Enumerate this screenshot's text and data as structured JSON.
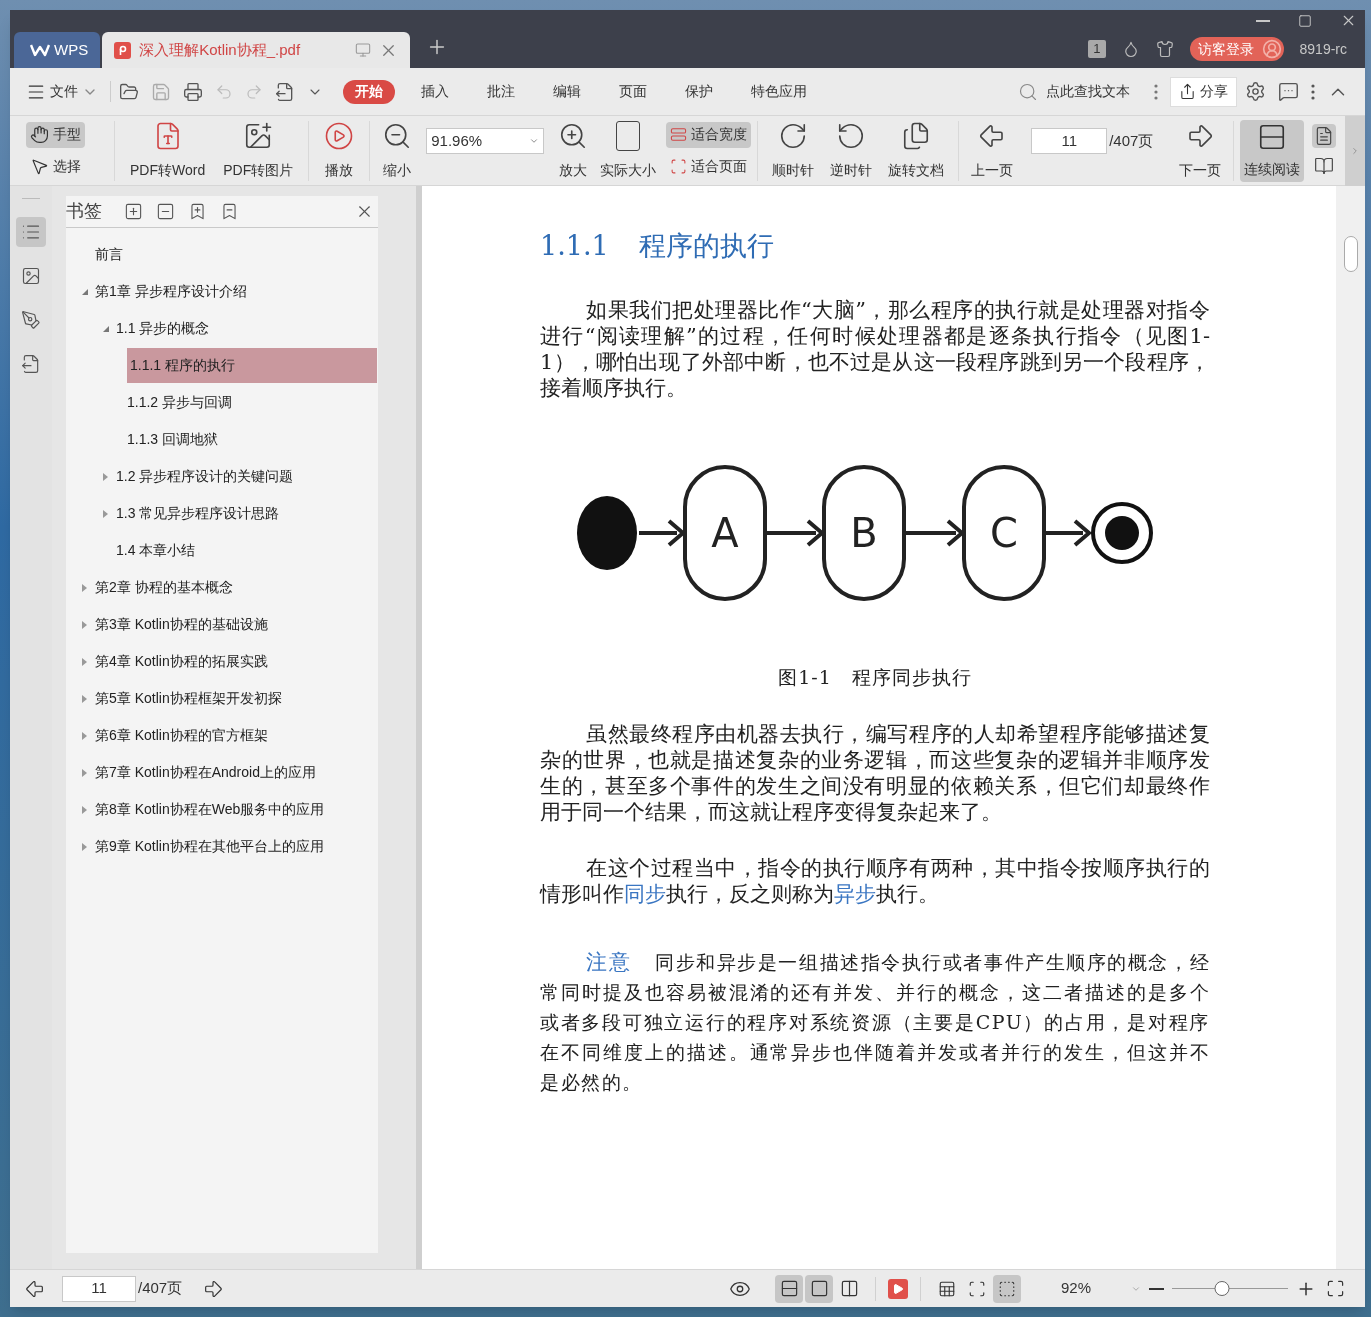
{
  "tabs": [
    {
      "kind": "home",
      "label": "WPS",
      "selected": false
    },
    {
      "kind": "document",
      "label": "深入理解Kotlin协程_.pdf",
      "selected": true
    }
  ],
  "title_bar": {
    "badge": "1",
    "login": "访客登录",
    "account": "8919-rc"
  },
  "menu_bar": {
    "file": "文件",
    "tabs": [
      {
        "label": "开始",
        "selected": true
      },
      {
        "label": "插入",
        "selected": false
      },
      {
        "label": "批注",
        "selected": false
      },
      {
        "label": "编辑",
        "selected": false
      },
      {
        "label": "页面",
        "selected": false
      },
      {
        "label": "保护",
        "selected": false
      },
      {
        "label": "特色应用",
        "selected": false
      }
    ],
    "search": {
      "placeholder": "点此查找文本"
    },
    "share": "分享"
  },
  "toolbar": {
    "modes": [
      {
        "kind": "hand",
        "label": "手型",
        "selected": true
      },
      {
        "kind": "select",
        "label": "选择",
        "selected": false
      }
    ],
    "convert_tools": [
      {
        "kind": "pdf-to-word",
        "label": "PDF转Word"
      },
      {
        "kind": "pdf-to-image",
        "label": "PDF转图片"
      },
      {
        "kind": "play",
        "label": "播放"
      }
    ],
    "zoom_out": "缩小",
    "zoom": "91.96%",
    "zoom_in": "放大",
    "actual_size": "实际大小",
    "fits": [
      {
        "kind": "fit-width",
        "label": "适合宽度",
        "selected": true
      },
      {
        "kind": "fit-page",
        "label": "适合页面",
        "selected": false
      }
    ],
    "rotate_tools": [
      {
        "kind": "clockwise",
        "label": "顺时针"
      },
      {
        "kind": "counterclockwise",
        "label": "逆时针"
      },
      {
        "kind": "rotate-document",
        "label": "旋转文档"
      }
    ],
    "prev": "上一页",
    "page": "11",
    "total": "/407页",
    "next": "下一页",
    "continuous": {
      "label": "连续阅读",
      "selected": true
    }
  },
  "rail": [
    {
      "kind": "bookmarks",
      "selected": true
    },
    {
      "kind": "thumbnails",
      "selected": false
    },
    {
      "kind": "annotations",
      "selected": false
    },
    {
      "kind": "convert",
      "selected": false
    }
  ],
  "bookmarks": {
    "title": "书签",
    "items": [
      {
        "label": "前言",
        "selected": false
      },
      {
        "label": "第1章 异步程序设计介绍",
        "selected": false,
        "expanded": true,
        "children": [
          {
            "label": "1.1 异步的概念",
            "selected": false,
            "expanded": true,
            "children": [
              {
                "label": "1.1.1 程序的执行",
                "selected": true
              },
              {
                "label": "1.1.2 异步与回调",
                "selected": false
              },
              {
                "label": "1.1.3 回调地狱",
                "selected": false
              }
            ]
          },
          {
            "label": "1.2 异步程序设计的关键问题",
            "selected": false,
            "expanded": false
          },
          {
            "label": "1.3 常见异步程序设计思路",
            "selected": false,
            "expanded": false
          },
          {
            "label": "1.4 本章小结",
            "selected": false
          }
        ]
      },
      {
        "label": "第2章 协程的基本概念",
        "selected": false,
        "expanded": false
      },
      {
        "label": "第3章 Kotlin协程的基础设施",
        "selected": false,
        "expanded": false
      },
      {
        "label": "第4章 Kotlin协程的拓展实践",
        "selected": false,
        "expanded": false
      },
      {
        "label": "第5章 Kotlin协程框架开发初探",
        "selected": false,
        "expanded": false
      },
      {
        "label": "第6章 Kotlin协程的官方框架",
        "selected": false,
        "expanded": false
      },
      {
        "label": "第7章 Kotlin协程在Android上的应用",
        "selected": false,
        "expanded": false
      },
      {
        "label": "第8章 Kotlin协程在Web服务中的应用",
        "selected": false,
        "expanded": false
      },
      {
        "label": "第9章 Kotlin协程在其他平台上的应用",
        "selected": false,
        "expanded": false
      }
    ]
  },
  "document": [
    {
      "kind": "heading",
      "number": "1.1.1",
      "text": "程序的执行"
    },
    {
      "kind": "paragraph",
      "segments": [
        {
          "kind": "plain",
          "text": "如果我们把处理器比作“大脑”，那么程序的执行就是处理器对指令进行“阅读理解”的过程，任何时候处理器都是逐条执行指令（见图1-1），哪怕出现了外部中断，也不过是从这一段程序跳到另一个段程序，接着顺序执行。"
        }
      ]
    },
    {
      "kind": "figure",
      "nodes": [
        "A",
        "B",
        "C"
      ],
      "caption": "图1-1　程序同步执行"
    },
    {
      "kind": "paragraph",
      "segments": [
        {
          "kind": "plain",
          "text": "虽然最终程序由机器去执行，编写程序的人却希望程序能够描述复杂的世界，也就是描述复杂的业务逻辑，而这些复杂的逻辑并非顺序发生的，甚至多个事件的发生之间没有明显的依赖关系，但它们却最终作用于同一个结果，而这就让程序变得复杂起来了。"
        }
      ]
    },
    {
      "kind": "paragraph",
      "segments": [
        {
          "kind": "plain",
          "text": "在这个过程当中，指令的执行顺序有两种，其中指令按顺序执行的情形叫作"
        },
        {
          "kind": "term",
          "text": "同步"
        },
        {
          "kind": "plain",
          "text": "执行，反之则称为"
        },
        {
          "kind": "term",
          "text": "异步"
        },
        {
          "kind": "plain",
          "text": "执行。"
        }
      ]
    },
    {
      "kind": "note",
      "label": "注意",
      "text": "同步和异步是一组描述指令执行或者事件产生顺序的概念，经常同时提及也容易被混淆的还有并发、并行的概念，这二者描述的是多个或者多段可独立运行的程序对系统资源（主要是CPU）的占用，是对程序在不同维度上的描述。通常异步也伴随着并发或者并行的发生，但这并不是必然的。"
    }
  ],
  "status_bar": {
    "page": "11",
    "total": "/407页",
    "view_modes": [
      {
        "kind": "continuous",
        "selected": true
      },
      {
        "kind": "single",
        "selected": true
      },
      {
        "kind": "two-page",
        "selected": false
      }
    ],
    "fit_modes": [
      {
        "kind": "actual",
        "selected": false
      },
      {
        "kind": "fit-page",
        "selected": false
      },
      {
        "kind": "fit-width",
        "selected": true
      }
    ],
    "zoom": "92%",
    "zoom_slider": {
      "level": 0.43
    }
  }
}
